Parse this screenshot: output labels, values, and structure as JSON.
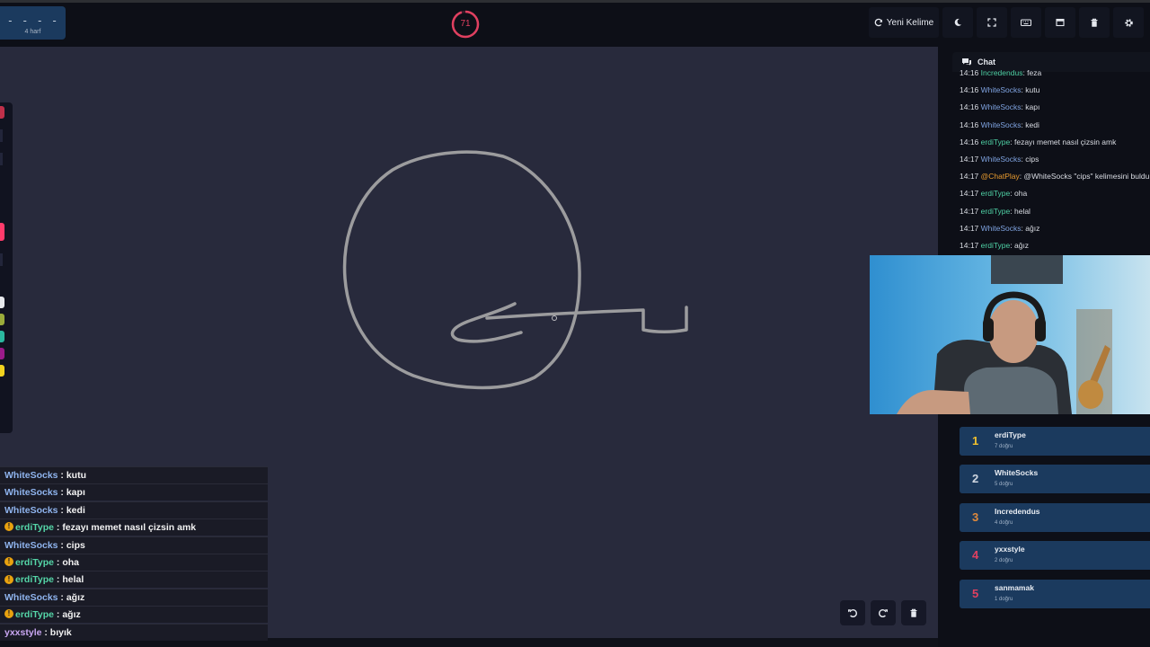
{
  "header": {
    "word_mask": "- - - -",
    "word_hint": "4 harf",
    "timer": "71",
    "timer_progress": 0.95,
    "new_word_label": "Yeni Kelime",
    "icons": [
      "refresh-icon",
      "moon-icon",
      "fullscreen-icon",
      "keyboard-icon",
      "window-icon",
      "trash-icon",
      "trash-icon",
      "gear-icon"
    ]
  },
  "chat": {
    "title": "Chat",
    "messages": [
      {
        "time": "14:16",
        "user": "Incredendus",
        "text": ": feza",
        "role": "inc"
      },
      {
        "time": "14:16",
        "user": "WhiteSocks",
        "text": ": kutu",
        "role": "white"
      },
      {
        "time": "14:16",
        "user": "WhiteSocks",
        "text": ": kapı",
        "role": "white"
      },
      {
        "time": "14:16",
        "user": "WhiteSocks",
        "text": ": kedi",
        "role": "white"
      },
      {
        "time": "14:16",
        "user": "erdiType",
        "text": ": fezayı memet nasıl çizsin amk",
        "role": "erdi"
      },
      {
        "time": "14:17",
        "user": "WhiteSocks",
        "text": ": cips",
        "role": "white"
      },
      {
        "time": "14:17",
        "user": "@ChatPlay",
        "text": ": @WhiteSocks \"cips\" kelimesini buldu",
        "role": "bot"
      },
      {
        "time": "14:17",
        "user": "erdiType",
        "text": ": oha",
        "role": "erdi"
      },
      {
        "time": "14:17",
        "user": "erdiType",
        "text": ": helal",
        "role": "erdi"
      },
      {
        "time": "14:17",
        "user": "WhiteSocks",
        "text": ": ağız",
        "role": "white"
      },
      {
        "time": "14:17",
        "user": "erdiType",
        "text": ": ağız",
        "role": "erdi"
      }
    ]
  },
  "overlay_chat": [
    {
      "user": "WhiteSocks",
      "text": " : kutu",
      "badge": false,
      "color": "#8fb4ee"
    },
    {
      "user": "WhiteSocks",
      "text": " : kapı",
      "badge": false,
      "color": "#8fb4ee"
    },
    {
      "user": "WhiteSocks",
      "text": " : kedi",
      "badge": false,
      "color": "#8fb4ee"
    },
    {
      "user": "erdiType",
      "text": " : fezayı memet nasıl çizsin amk",
      "badge": true,
      "color": "#55d6a8"
    },
    {
      "user": "WhiteSocks",
      "text": " : cips",
      "badge": false,
      "color": "#8fb4ee"
    },
    {
      "user": "erdiType",
      "text": " : oha",
      "badge": true,
      "color": "#55d6a8"
    },
    {
      "user": "erdiType",
      "text": " : helal",
      "badge": true,
      "color": "#55d6a8"
    },
    {
      "user": "WhiteSocks",
      "text": " : ağız",
      "badge": false,
      "color": "#8fb4ee"
    },
    {
      "user": "erdiType",
      "text": " : ağız",
      "badge": true,
      "color": "#55d6a8"
    },
    {
      "user": "yxxstyle",
      "text": " : bıyık",
      "badge": false,
      "color": "#c9a6f2"
    }
  ],
  "leaderboard": [
    {
      "rank": "1",
      "name": "erdiType",
      "score": "7 doğru",
      "color": "#f2c12e"
    },
    {
      "rank": "2",
      "name": "WhiteSocks",
      "score": "5 doğru",
      "color": "#cfd6e0"
    },
    {
      "rank": "3",
      "name": "Incredendus",
      "score": "4 doğru",
      "color": "#e08a3c"
    },
    {
      "rank": "4",
      "name": "yxxstyle",
      "score": "2 doğru",
      "color": "#e04060"
    },
    {
      "rank": "5",
      "name": "sanmamak",
      "score": "1 doğru",
      "color": "#e04060"
    }
  ],
  "toolbar": {
    "colors": [
      "#e8eaee",
      "#9aab3a",
      "#2bb9a0",
      "#9b1b8a",
      "#f2d21e"
    ],
    "active_color": "#ff3b6b",
    "close_color": "#c0304a"
  },
  "canvas_controls": {
    "icons": [
      "undo-icon",
      "redo-icon",
      "trash-icon"
    ]
  },
  "colors": {
    "accent_red": "#e04060",
    "panel_blue": "#1b3a5e"
  }
}
